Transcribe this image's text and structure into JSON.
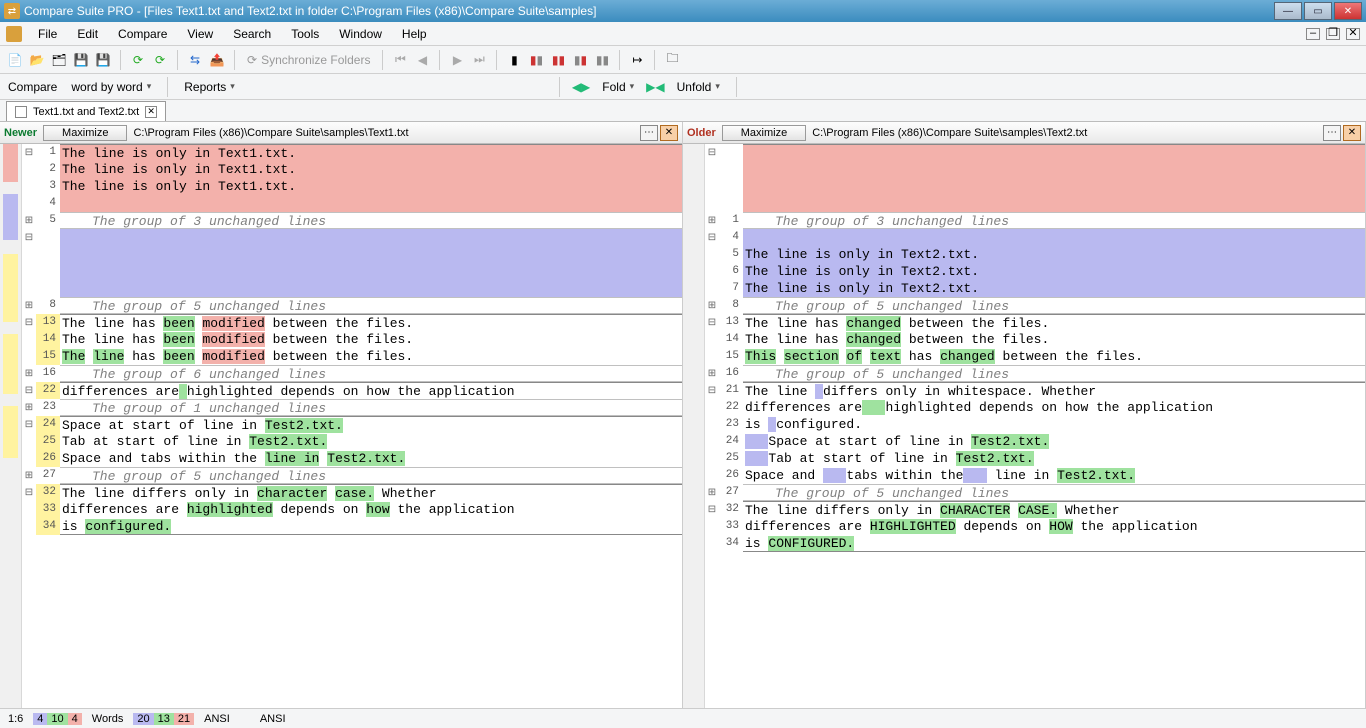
{
  "title": "Compare Suite PRO - [Files Text1.txt and Text2.txt in folder C:\\Program Files (x86)\\Compare Suite\\samples]",
  "menu": [
    "File",
    "Edit",
    "Compare",
    "View",
    "Search",
    "Tools",
    "Window",
    "Help"
  ],
  "toolbar": {
    "sync_label": "Synchronize Folders"
  },
  "toolbar2": {
    "compare_label": "Compare",
    "mode": "word by word",
    "reports": "Reports",
    "fold": "Fold",
    "unfold": "Unfold"
  },
  "tab": {
    "label": "Text1.txt and Text2.txt"
  },
  "left": {
    "age": "Newer",
    "maximize": "Maximize",
    "path": "C:\\Program Files (x86)\\Compare Suite\\samples\\Text1.txt"
  },
  "right": {
    "age": "Older",
    "maximize": "Maximize",
    "path": "C:\\Program Files (x86)\\Compare Suite\\samples\\Text2.txt"
  },
  "text": {
    "only_t1": "The line is only in Text1.txt.",
    "only_t2": "The line is only in Text2.txt.",
    "group3": "The group of 3 unchanged lines",
    "group5": "The group of 5 unchanged lines",
    "group6": "The group of 6 unchanged lines",
    "group1": "The group of 1 unchanged lines"
  },
  "status": {
    "pos": "1:6",
    "c1": "4",
    "c2": "10",
    "c3": "4",
    "words": "Words",
    "w1": "20",
    "w2": "13",
    "w3": "21",
    "enc1": "ANSI",
    "enc2": "ANSI"
  }
}
